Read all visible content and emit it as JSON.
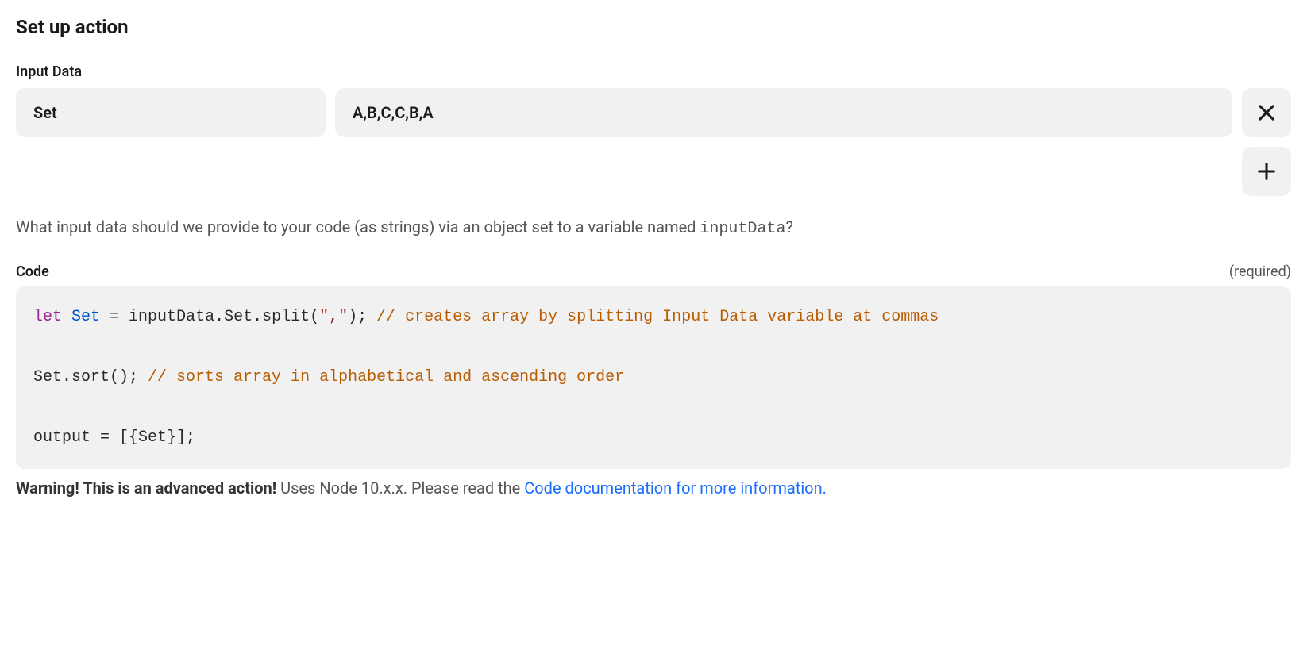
{
  "title": "Set up action",
  "inputData": {
    "label": "Input Data",
    "rows": [
      {
        "key": "Set",
        "value": "A,B,C,C,B,A"
      }
    ],
    "helper_prefix": "What input data should we provide to your code (as strings) via an object set to a variable named ",
    "helper_var": "inputData",
    "helper_suffix": "?"
  },
  "code": {
    "label": "Code",
    "required_label": "(required)",
    "tokens_line1": [
      {
        "cls": "tok-kw",
        "t": "let"
      },
      {
        "cls": "tok-plain",
        "t": " "
      },
      {
        "cls": "tok-var",
        "t": "Set"
      },
      {
        "cls": "tok-plain",
        "t": " = inputData.Set.split("
      },
      {
        "cls": "tok-str",
        "t": "\",\""
      },
      {
        "cls": "tok-plain",
        "t": "); "
      },
      {
        "cls": "tok-com",
        "t": "// creates array by splitting Input Data variable at commas"
      }
    ],
    "tokens_line3": [
      {
        "cls": "tok-plain",
        "t": "Set.sort(); "
      },
      {
        "cls": "tok-com",
        "t": "// sorts array in alphabetical and ascending order"
      }
    ],
    "tokens_line5": [
      {
        "cls": "tok-plain",
        "t": "output = [{Set}];"
      }
    ]
  },
  "warning": {
    "bold": "Warning! This is an advanced action!",
    "middle": " Uses Node 10.x.x. Please read the ",
    "link": "Code documentation for more information.",
    "after": ""
  }
}
